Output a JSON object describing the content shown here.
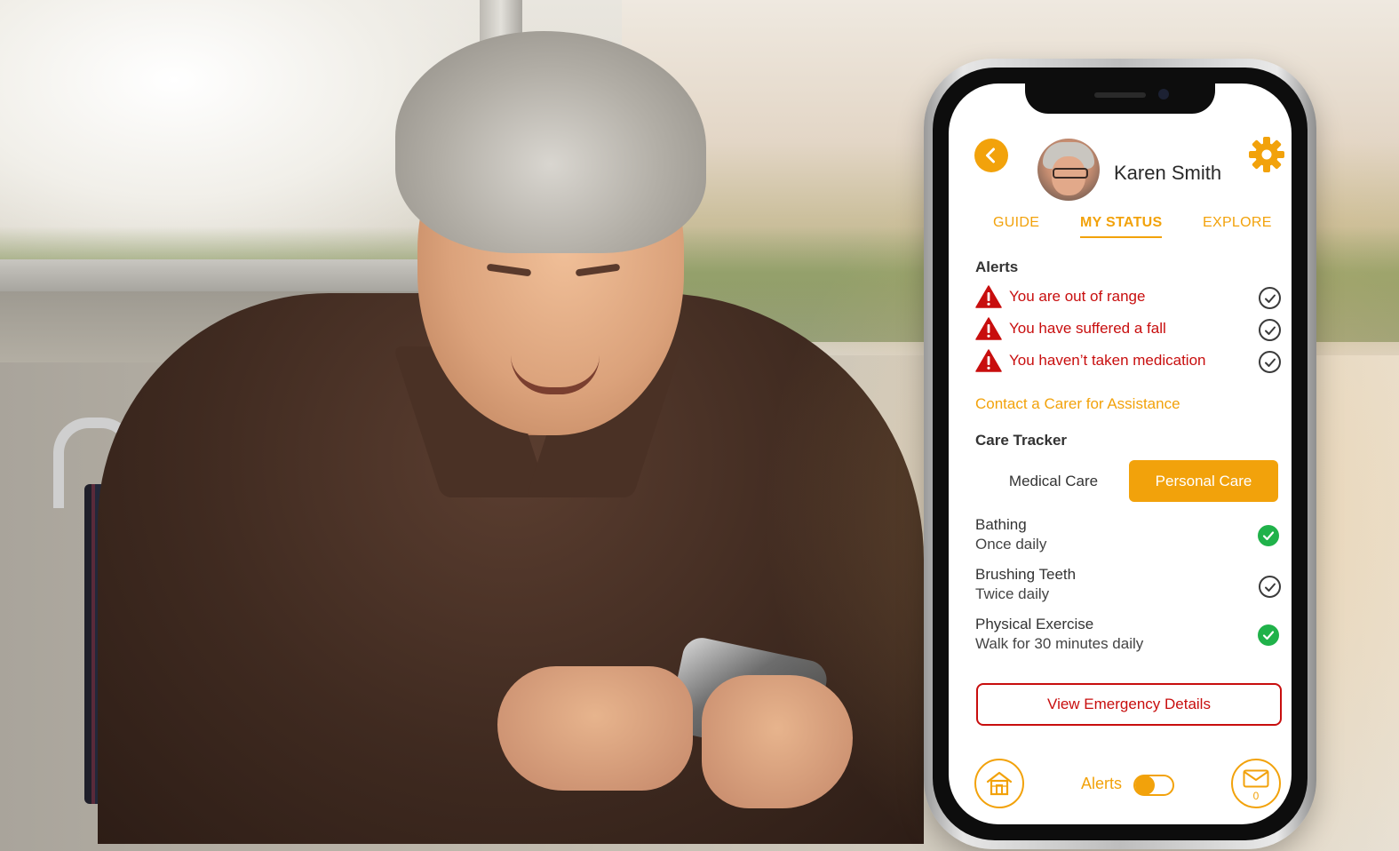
{
  "profile": {
    "name": "Karen Smith"
  },
  "tabs": [
    {
      "label": "GUIDE",
      "active": false
    },
    {
      "label": "MY STATUS",
      "active": true
    },
    {
      "label": "EXPLORE",
      "active": false
    }
  ],
  "alerts": {
    "title": "Alerts",
    "items": [
      {
        "text": "You are out of range",
        "acknowledged": false
      },
      {
        "text": "You have suffered a fall",
        "acknowledged": false
      },
      {
        "text": "You haven’t taken medication",
        "acknowledged": false
      }
    ],
    "contact_link": "Contact a Carer for Assistance"
  },
  "care_tracker": {
    "title": "Care Tracker",
    "segments": [
      {
        "label": "Medical Care",
        "selected": false
      },
      {
        "label": "Personal Care",
        "selected": true
      }
    ],
    "items": [
      {
        "name": "Bathing",
        "frequency": "Once daily",
        "done": true
      },
      {
        "name": "Brushing Teeth",
        "frequency": "Twice daily",
        "done": false
      },
      {
        "name": "Physical Exercise",
        "frequency": "Walk for 30 minutes daily",
        "done": true
      }
    ]
  },
  "emergency_button": "View Emergency Details",
  "bottom_bar": {
    "alerts_label": "Alerts",
    "alerts_toggle_on": false,
    "mail_count": "0"
  },
  "colors": {
    "accent": "#f2a20b",
    "alert_red": "#c80e0e",
    "done_green": "#20b24a"
  },
  "icons": [
    "back-arrow-icon",
    "gear-icon",
    "warning-icon",
    "check-icon",
    "home-icon",
    "mail-icon"
  ]
}
